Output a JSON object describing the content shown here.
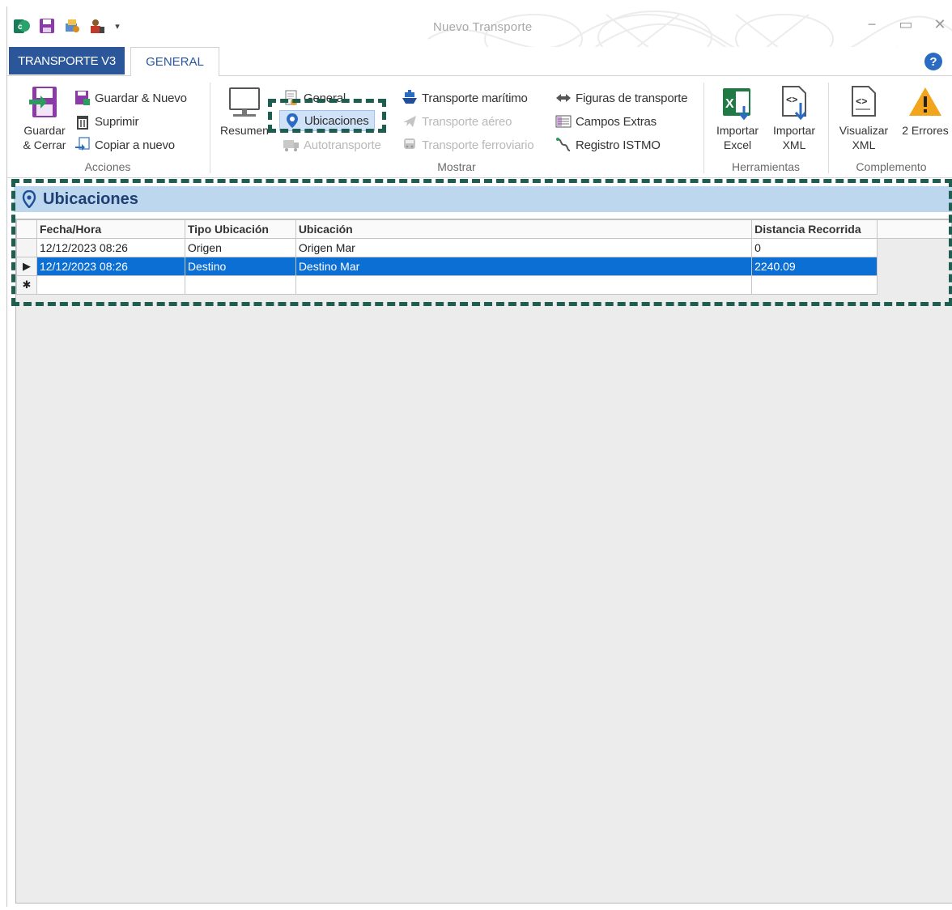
{
  "window": {
    "title": "Nuevo Transporte",
    "controls": {
      "minimize": "−",
      "restore": "▭",
      "close": "✕"
    }
  },
  "quick_access": [
    "app-icon",
    "save-icon",
    "settings-icon",
    "user-icon",
    "dropdown-arrow-icon"
  ],
  "tabs": [
    {
      "label": "TRANSPORTE V3",
      "active": false
    },
    {
      "label": "GENERAL",
      "active": true
    }
  ],
  "help": {
    "label": "?"
  },
  "ribbon": {
    "acciones": {
      "label": "Acciones",
      "guardar_cerrar": "Guardar\n& Cerrar",
      "guardar_nuevo": "Guardar & Nuevo",
      "suprimir": "Suprimir",
      "copiar_nuevo": "Copiar a nuevo"
    },
    "mostrar": {
      "label": "Mostrar",
      "resumen": "Resumen",
      "general": "General",
      "ubicaciones": "Ubicaciones",
      "autotransporte": "Autotransporte",
      "transporte_maritimo": "Transporte marítimo",
      "transporte_aereo": "Transporte aéreo",
      "transporte_ferroviario": "Transporte ferroviario",
      "figuras_transporte": "Figuras de transporte",
      "campos_extras": "Campos Extras",
      "registro_istmo": "Registro ISTMO"
    },
    "herramientas": {
      "label": "Herramientas",
      "importar_excel": "Importar\nExcel",
      "importar_xml": "Importar\nXML"
    },
    "complemento": {
      "label": "Complemento",
      "visualizar_xml": "Visualizar\nXML",
      "errores": "2 Errores"
    }
  },
  "panel": {
    "title": "Ubicaciones",
    "table": {
      "columns": [
        "Fecha/Hora",
        "Tipo Ubicación",
        "Ubicación",
        "Distancia Recorrida"
      ],
      "rows": [
        {
          "marker": "",
          "cells": [
            "12/12/2023 08:26",
            "Origen",
            "Origen Mar",
            "0"
          ],
          "selected": false
        },
        {
          "marker": "▶",
          "cells": [
            "12/12/2023 08:26",
            "Destino",
            "Destino Mar",
            "2240.09"
          ],
          "selected": true
        }
      ],
      "new_row_marker": "✱"
    }
  },
  "colors": {
    "accent": "#2b579a",
    "panel_header": "#bdd7ee",
    "selection": "#0b6fd3",
    "highlight": "#1e5e50"
  }
}
